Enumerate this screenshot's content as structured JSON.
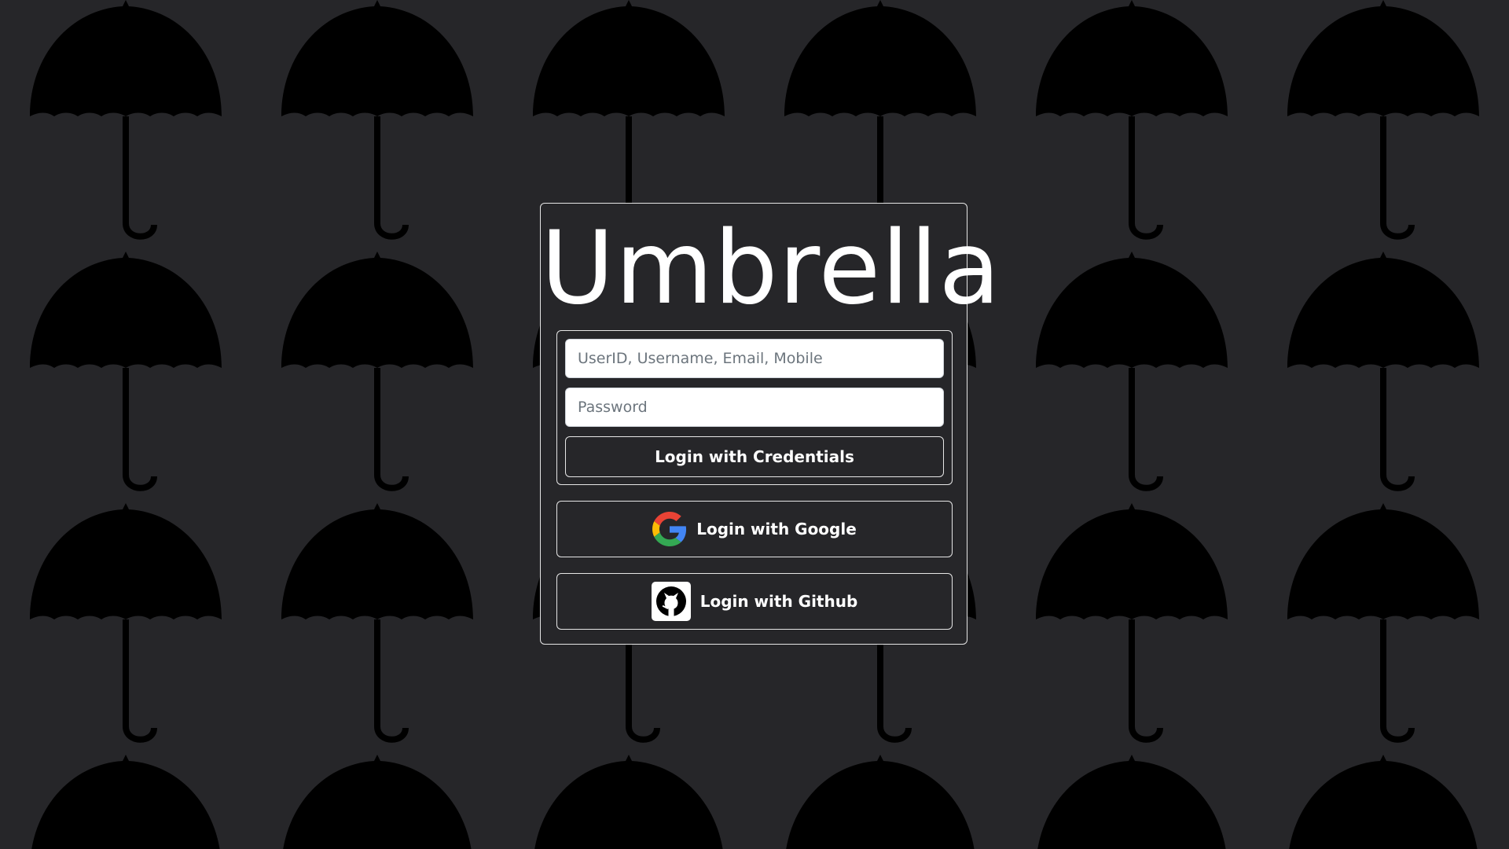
{
  "app": {
    "title": "Umbrella"
  },
  "login_form": {
    "identifier_placeholder": "UserID, Username, Email, Mobile",
    "password_placeholder": "Password",
    "credentials_button_label": "Login with Credentials"
  },
  "oauth": {
    "google_label": "Login with Google",
    "google_icon": "google-g-icon",
    "github_label": "Login with Github",
    "github_icon": "github-octocat-icon"
  },
  "theme": {
    "background": "#262629",
    "umbrella_pattern": "#000000",
    "border": "#e6e6e6",
    "text": "#ffffff"
  }
}
